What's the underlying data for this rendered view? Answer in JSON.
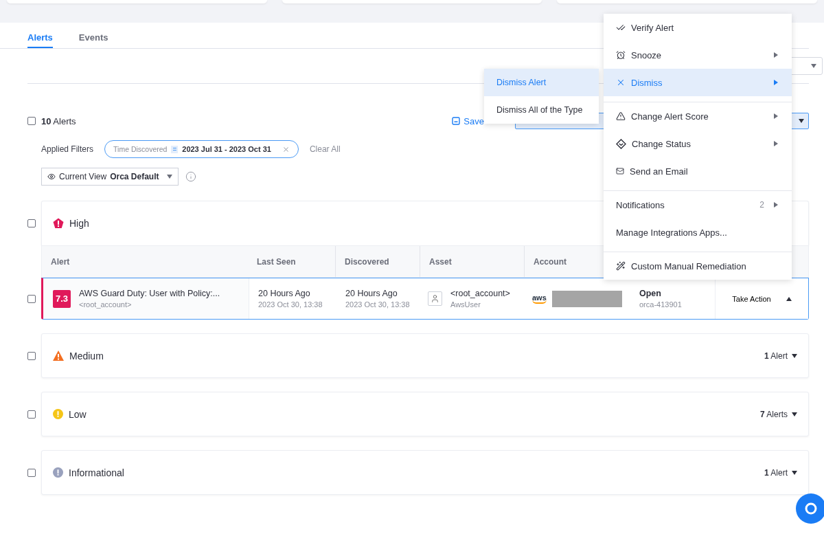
{
  "tabs": [
    {
      "label": "Alerts",
      "selected": true
    },
    {
      "label": "Events",
      "selected": false
    }
  ],
  "toolbar": {
    "select_all_checked": false,
    "total": "**10** Alerts",
    "save_view": "Save"
  },
  "filters": {
    "label": "Applied Filters",
    "chips": [
      {
        "field": "Time Discovered",
        "operator": "=",
        "value": "2023 Jul 31 - 2023 Oct 31"
      }
    ],
    "clear": "Clear All"
  },
  "view": {
    "label": "Current View",
    "value": "Orca Default"
  },
  "groups": [
    {
      "kind": "high",
      "label": "High",
      "checked": false,
      "expanded": true
    },
    {
      "kind": "medium",
      "label": "Medium",
      "checked": false,
      "expanded": false,
      "count": "**1** Alert"
    },
    {
      "kind": "low",
      "label": "Low",
      "checked": false,
      "expanded": false,
      "count": "**7** Alerts"
    },
    {
      "kind": "informational",
      "label": "Informational",
      "checked": false,
      "expanded": false,
      "count": "**1** Alert"
    }
  ],
  "table": {
    "columns": [
      "Alert",
      "Last Seen",
      "Discovered",
      "Asset",
      "Account"
    ],
    "rows": [
      {
        "checked": false,
        "selected": true,
        "score": "7.3",
        "title": "AWS Guard Duty: User with Policy:...",
        "subtitle": "<root_account>",
        "last_seen": "20 Hours Ago",
        "last_seen_date": "2023 Oct 30, 13:38",
        "discovered": "20 Hours Ago",
        "discovered_date": "2023 Oct 30, 13:38",
        "asset": "<root_account>",
        "asset_type": "AwsUser",
        "account_logo": "aws",
        "status": "Open",
        "status_id": "orca-413901",
        "action": "Take Action",
        "action_open": true
      }
    ]
  },
  "menu": {
    "sections": [
      [
        {
          "label": "Verify Alert",
          "selected": false,
          "submenu": false
        },
        {
          "label": "Snooze",
          "selected": false,
          "submenu": true
        },
        {
          "label": "Dismiss",
          "selected": true,
          "submenu": true
        }
      ],
      [
        {
          "label": "Change Alert Score",
          "selected": false,
          "submenu": true
        },
        {
          "label": "Change Status",
          "selected": false,
          "submenu": true
        },
        {
          "label": "Send an Email",
          "selected": false,
          "submenu": false
        }
      ],
      [
        {
          "label": "Notifications",
          "selected": false,
          "submenu": true,
          "badge": "2"
        },
        {
          "label": "Manage Integrations Apps...",
          "selected": false,
          "submenu": false
        }
      ],
      [
        {
          "label": "Custom Manual Remediation",
          "selected": false,
          "submenu": false
        }
      ]
    ]
  },
  "submenu": {
    "items": [
      {
        "label": "Dismiss Alert",
        "selected": true
      },
      {
        "label": "Dismiss All of the Type",
        "selected": false
      }
    ]
  }
}
